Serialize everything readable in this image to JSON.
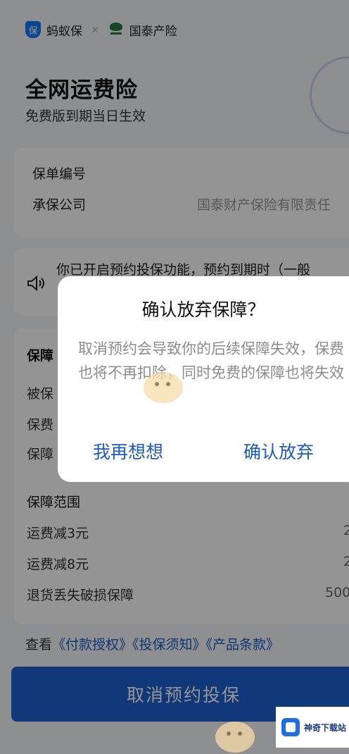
{
  "header": {
    "brand_left": "蚂蚁保",
    "brand_sep": "×",
    "brand_right": "国泰产险",
    "shield_glyph": "保"
  },
  "product": {
    "title": "全网运费险",
    "subtitle": "免费版到期当日生效"
  },
  "info": {
    "policy_no_label": "保单编号",
    "insurer_label": "承保公司",
    "insurer_value": "国泰财产保险有限责任"
  },
  "notice": {
    "text": "你已开启预约投保功能，预约到期时（一般"
  },
  "coverage": {
    "section_title": "保障",
    "row1": "被保",
    "row2": "保费",
    "row3": "保障",
    "scope_title": "保障范围",
    "items": [
      {
        "label": "运费减3元",
        "value": "2"
      },
      {
        "label": "运费减8元",
        "value": "2"
      },
      {
        "label": "退货丢失破损保障",
        "value": "500"
      }
    ]
  },
  "links": {
    "prefix": "查看",
    "link1": "《付款授权》",
    "link2": "《投保须知》",
    "link3": "《产品条款》"
  },
  "cta": {
    "label": "取消预约投保"
  },
  "dialog": {
    "title": "确认放弃保障？",
    "body": "取消预约会导致你的后续保障失效，保费也将不再扣除，同时免费的保障也将失效",
    "cancel_label": "我再想想",
    "confirm_label": "确认放弃"
  },
  "watermark": {
    "site_name": "神奇下载站"
  },
  "colors": {
    "primary": "#1e63d3",
    "link": "#1b5ac7",
    "overlay": "rgba(0,0,0,0.42)"
  }
}
